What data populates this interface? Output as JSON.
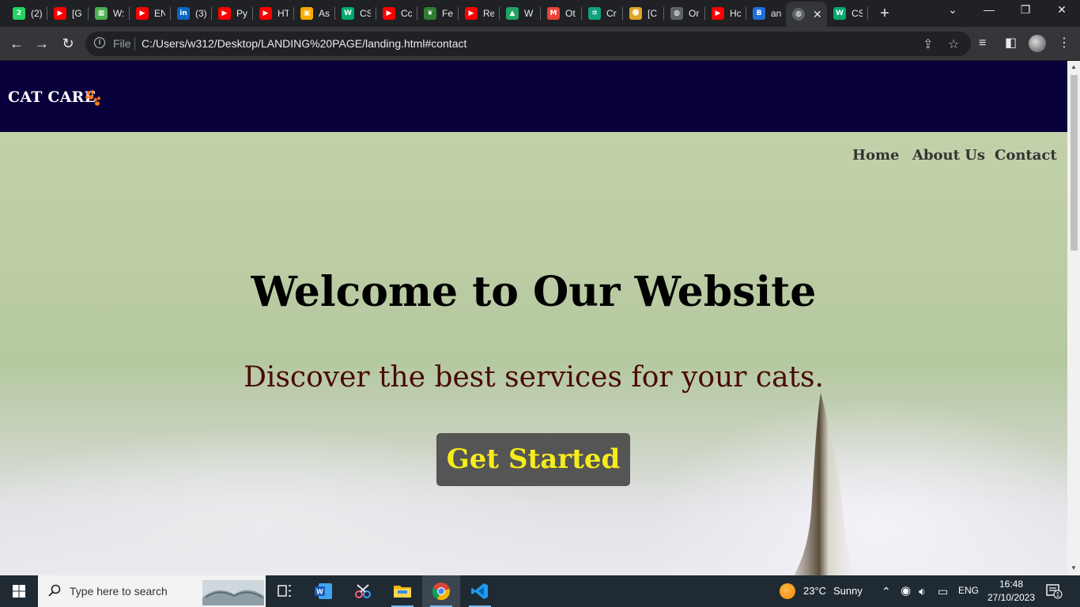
{
  "browser": {
    "tabs": [
      {
        "label": "(2)",
        "icon": "whatsapp-icon",
        "color": "#25d366",
        "glyph": "2"
      },
      {
        "label": "[G",
        "icon": "youtube-icon",
        "color": "#ff0000",
        "glyph": "▶"
      },
      {
        "label": "W:",
        "icon": "image-icon",
        "color": "#4caf50",
        "glyph": "▦"
      },
      {
        "label": "EN",
        "icon": "youtube-icon",
        "color": "#ff0000",
        "glyph": "▶"
      },
      {
        "label": "(3)",
        "icon": "linkedin-icon",
        "color": "#0a66c2",
        "glyph": "in"
      },
      {
        "label": "Py",
        "icon": "youtube-icon",
        "color": "#ff0000",
        "glyph": "▶"
      },
      {
        "label": "HT",
        "icon": "youtube-icon",
        "color": "#ff0000",
        "glyph": "▶"
      },
      {
        "label": "As",
        "icon": "classroom-icon",
        "color": "#f9ab00",
        "glyph": "▣"
      },
      {
        "label": "CS",
        "icon": "w3schools-icon",
        "color": "#04aa6d",
        "glyph": "W"
      },
      {
        "label": "Cc",
        "icon": "youtube-icon",
        "color": "#ff0000",
        "glyph": "▶"
      },
      {
        "label": "Fe",
        "icon": "leaf-icon",
        "color": "#2e7d32",
        "glyph": "❦"
      },
      {
        "label": "Re",
        "icon": "youtube-icon",
        "color": "#ff0000",
        "glyph": "▶"
      },
      {
        "label": "W",
        "icon": "drive-icon",
        "color": "#1fa463",
        "glyph": "▲"
      },
      {
        "label": "Ot",
        "icon": "gmail-icon",
        "color": "#ea4335",
        "glyph": "M"
      },
      {
        "label": "Cr",
        "icon": "chatgpt-icon",
        "color": "#10a37f",
        "glyph": "✲"
      },
      {
        "label": "[C",
        "icon": "avatar-icon",
        "color": "#e0a526",
        "glyph": "☻"
      },
      {
        "label": "Or",
        "icon": "globe-icon",
        "color": "#5f6368",
        "glyph": "◍"
      },
      {
        "label": "Hc",
        "icon": "youtube-icon",
        "color": "#ff0000",
        "glyph": "▶"
      },
      {
        "label": "an",
        "icon": "bing-icon",
        "color": "#1e6fd9",
        "glyph": "B"
      }
    ],
    "active_tab": {
      "label": "",
      "icon": "globe-icon"
    },
    "last_tab": {
      "label": "CS",
      "icon": "w3schools-icon",
      "color": "#04aa6d",
      "glyph": "W"
    },
    "omnibox": {
      "scheme_label": "File",
      "url": "C:/Users/w312/Desktop/LANDING%20PAGE/landing.html#contact"
    }
  },
  "site": {
    "brand": "CAT CARE",
    "nav": {
      "home": "Home",
      "about": "About Us",
      "contact": "Contact"
    },
    "hero": {
      "title": "Welcome to Our Website",
      "subtitle": "Discover the best services for your cats.",
      "cta": "Get Started"
    },
    "colors": {
      "header_bg": "#08003a",
      "cta_bg": "#555555",
      "cta_text": "#f5ec1c",
      "subtitle_text": "#4a0a0a"
    }
  },
  "taskbar": {
    "search_placeholder": "Type here to search",
    "weather": {
      "temp": "23°C",
      "condition": "Sunny"
    },
    "language": "ENG",
    "time": "16:48",
    "date": "27/10/2023",
    "notification_count": "1"
  }
}
